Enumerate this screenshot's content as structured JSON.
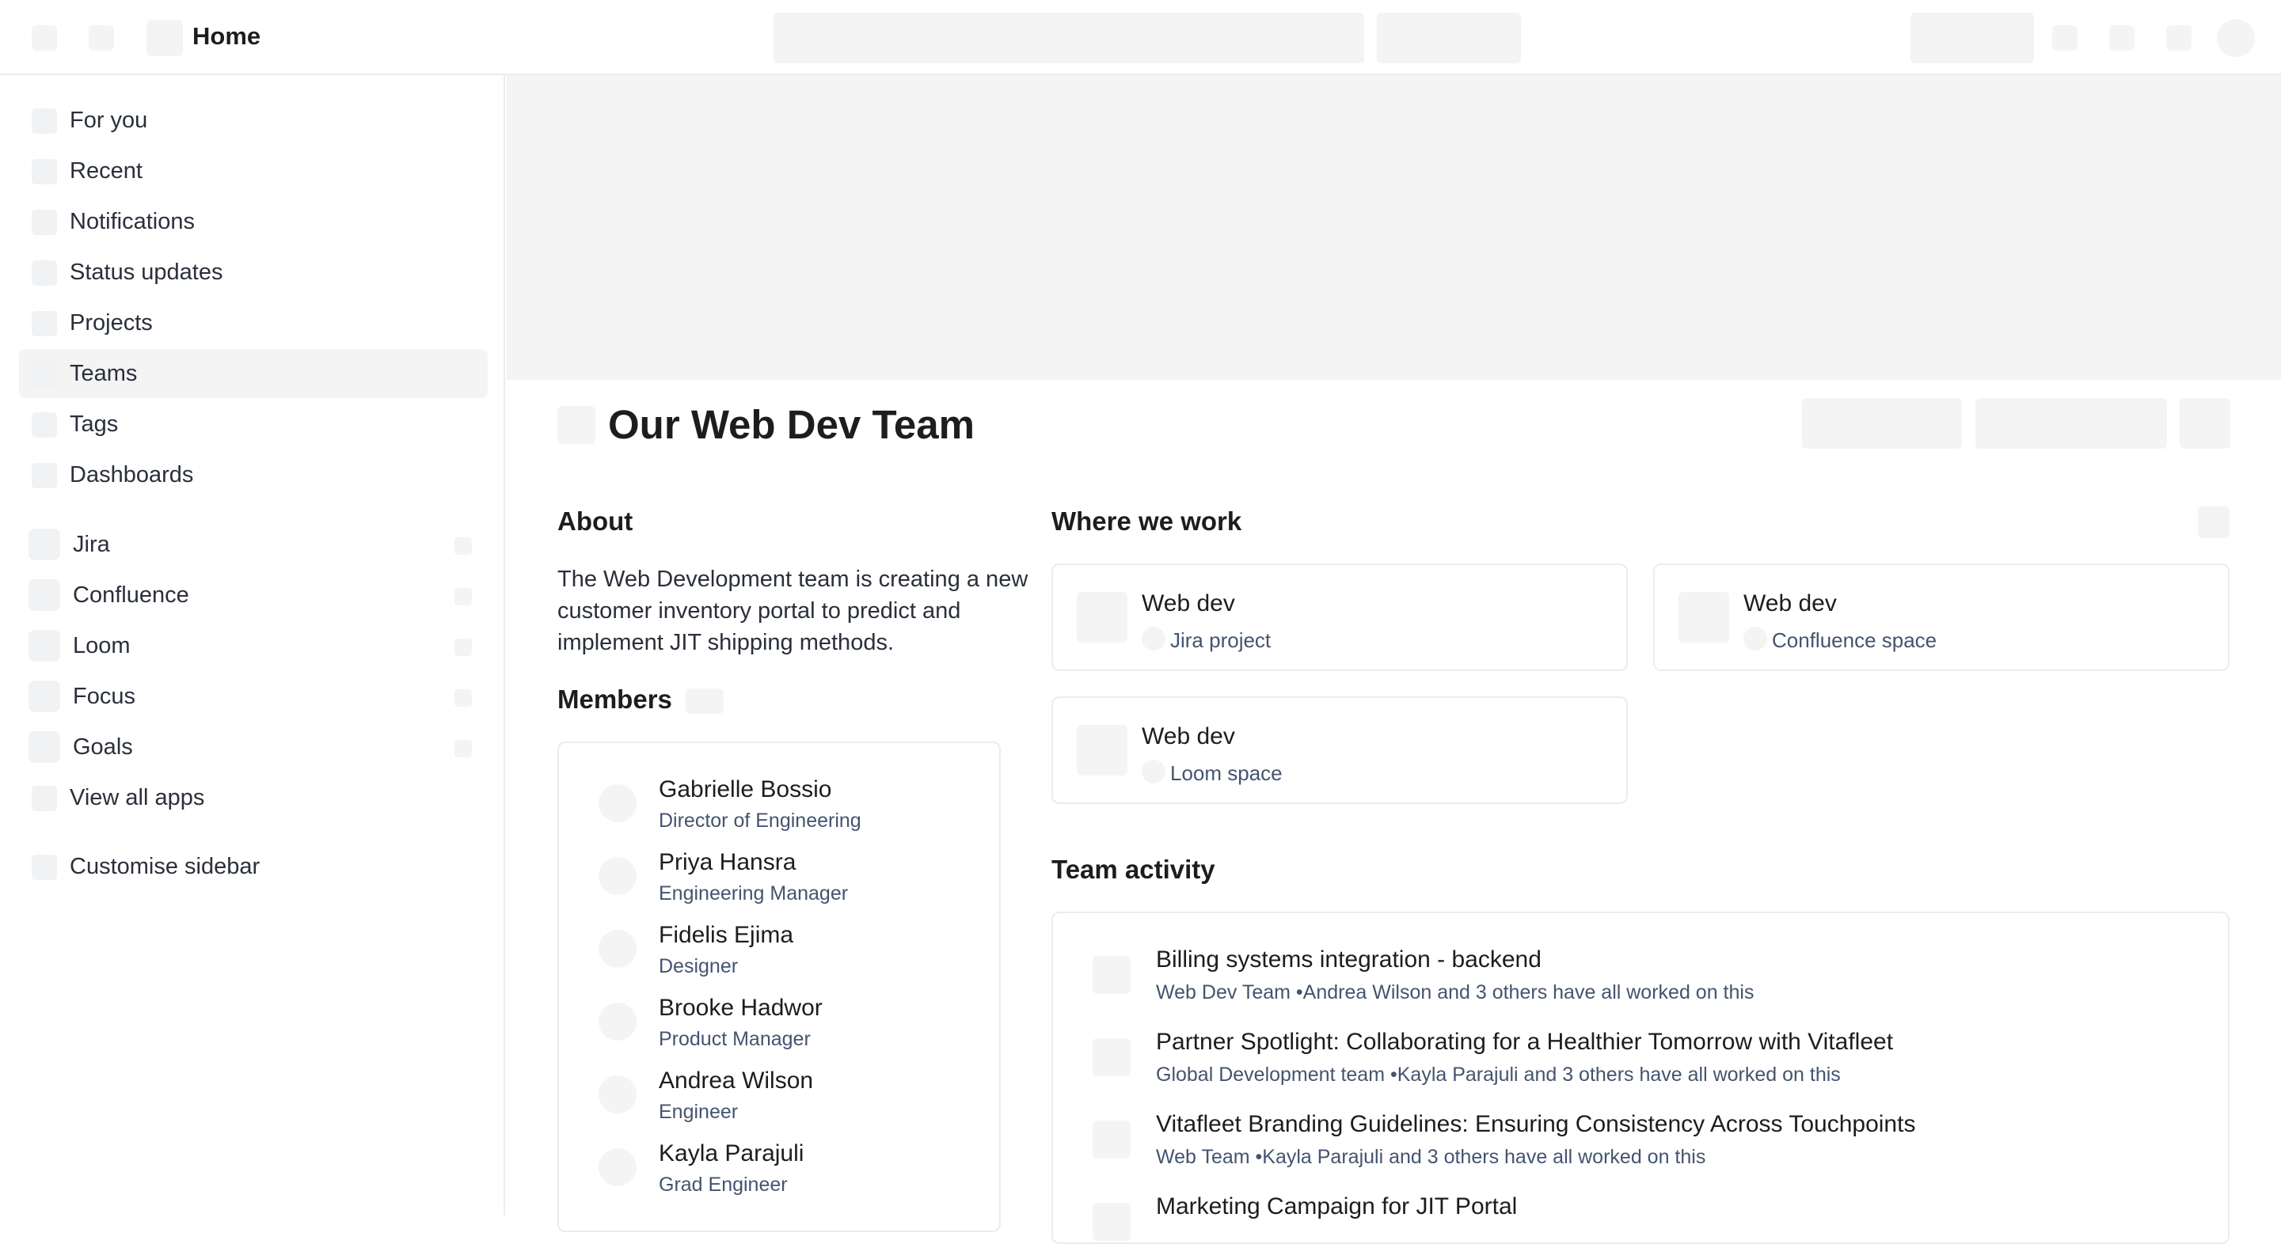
{
  "header": {
    "title": "Home"
  },
  "sidebar": {
    "items": [
      {
        "label": "For you"
      },
      {
        "label": "Recent"
      },
      {
        "label": "Notifications"
      },
      {
        "label": "Status updates"
      },
      {
        "label": "Projects"
      },
      {
        "label": "Teams",
        "active": true
      },
      {
        "label": "Tags"
      },
      {
        "label": "Dashboards"
      }
    ],
    "apps": [
      {
        "label": "Jira"
      },
      {
        "label": "Confluence"
      },
      {
        "label": "Loom"
      },
      {
        "label": "Focus"
      },
      {
        "label": "Goals"
      }
    ],
    "view_all": "View all apps",
    "customise": "Customise sidebar"
  },
  "team": {
    "title": "Our Web Dev Team",
    "about_heading": "About",
    "about_text": "The Web Development team is creating a new customer inventory portal to predict and implement JIT shipping methods.",
    "members_heading": "Members",
    "members": [
      {
        "name": "Gabrielle Bossio",
        "role": "Director of Engineering"
      },
      {
        "name": "Priya Hansra",
        "role": "Engineering Manager"
      },
      {
        "name": "Fidelis Ejima",
        "role": "Designer"
      },
      {
        "name": "Brooke Hadwor",
        "role": "Product Manager"
      },
      {
        "name": "Andrea Wilson",
        "role": "Engineer"
      },
      {
        "name": "Kayla Parajuli",
        "role": "Grad Engineer"
      }
    ]
  },
  "where_we_work": {
    "heading": "Where we work",
    "cards": [
      {
        "title": "Web dev",
        "subtitle": "Jira project"
      },
      {
        "title": "Web dev",
        "subtitle": "Confluence space"
      },
      {
        "title": "Web dev",
        "subtitle": "Loom space"
      }
    ]
  },
  "team_activity": {
    "heading": "Team activity",
    "items": [
      {
        "title": "Billing systems integration - backend",
        "subtitle": "Web Dev Team •Andrea Wilson and 3 others have all worked on this"
      },
      {
        "title": "Partner Spotlight: Collaborating for a Healthier Tomorrow with Vitafleet",
        "subtitle": "Global Development team •Kayla Parajuli and 3 others have all worked on this"
      },
      {
        "title": "Vitafleet Branding Guidelines: Ensuring Consistency Across Touchpoints",
        "subtitle": "Web Team •Kayla Parajuli and 3 others have all worked on this"
      },
      {
        "title": "Marketing Campaign for JIT Portal",
        "subtitle": ""
      }
    ]
  },
  "colors": {
    "placeholder": "#f4f4f5",
    "border": "#ebecf0",
    "text": "#1d1d1f",
    "muted": "#44546f"
  }
}
